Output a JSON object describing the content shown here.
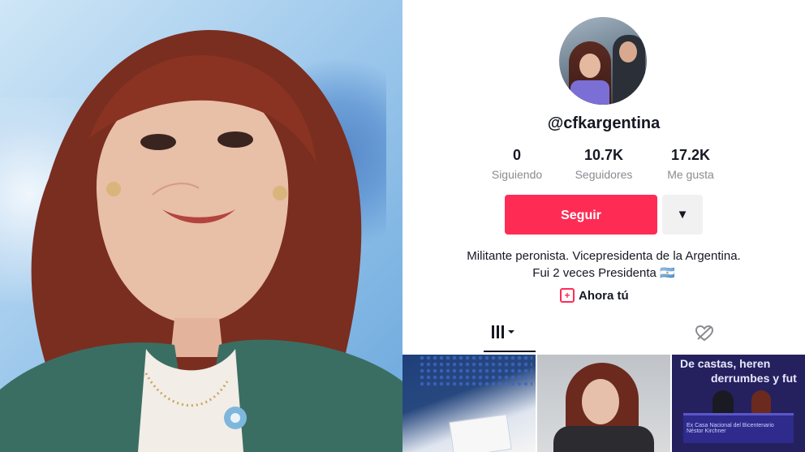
{
  "profile": {
    "handle": "@cfkargentina",
    "stats": [
      {
        "value": "0",
        "label": "Siguiendo"
      },
      {
        "value": "10.7K",
        "label": "Seguidores"
      },
      {
        "value": "17.2K",
        "label": "Me gusta"
      }
    ],
    "follow_label": "Seguir",
    "more_icon": "▼",
    "bio_line1": "Militante peronista. Vicepresidenta de la Argentina.",
    "bio_line2": "Fui 2 veces Presidenta 🇦🇷",
    "ahora_label": "Ahora tú"
  },
  "tabs": {
    "videos_icon": "grid-icon",
    "liked_icon": "liked-hidden-icon"
  },
  "thumbnails": [
    {
      "caption": ""
    },
    {
      "caption": ""
    },
    {
      "caption_line1": "De castas, heren",
      "caption_line2": "derrumbes y fut",
      "table_text": "Ex Casa Nacional del Bicentenario Néstor Kirchner"
    }
  ],
  "colors": {
    "accent": "#fe2c55",
    "text_primary": "#161823",
    "text_secondary": "#8a8b91"
  }
}
